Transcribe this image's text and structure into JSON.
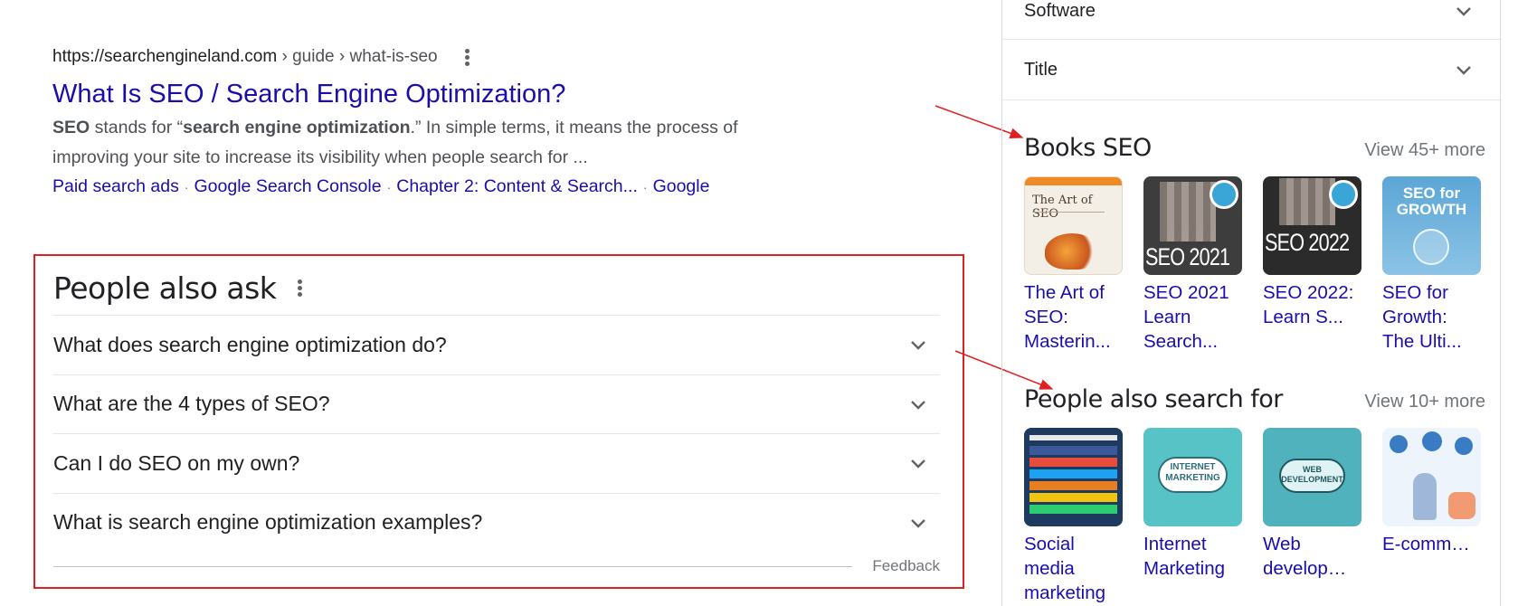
{
  "result": {
    "cite_domain": "https://searchengineland.com",
    "cite_path": " › guide › what-is-seo",
    "title": "What Is SEO / Search Engine Optimization?",
    "snippet_line1_parts": [
      "SEO",
      " stands for “",
      "search engine optimization",
      ".” In simple terms, it means the process of"
    ],
    "snippet_line2": "improving your site to increase its visibility when people search for ...",
    "sitelinks": [
      "Paid search ads",
      "Google Search Console",
      "Chapter 2: Content & Search...",
      "Google"
    ],
    "sitelink_separator": "·"
  },
  "people_also_ask": {
    "title": "People also ask",
    "questions": [
      "What does search engine optimization do?",
      "What are the 4 types of SEO?",
      "Can I do SEO on my own?",
      "What is search engine optimization examples?"
    ],
    "feedback": "Feedback"
  },
  "side_panel": {
    "accordions": [
      "Software",
      "Title"
    ],
    "books": {
      "title": "Books SEO",
      "more": "View 45+ more",
      "items": [
        {
          "label": "The Art of SEO: Masterin...",
          "cover_title": "The Art of SEO"
        },
        {
          "label": "SEO 2021 Learn Search...",
          "cover_title": "SEO 2021"
        },
        {
          "label": "SEO 2022: Learn S...",
          "cover_title": "SEO 2022"
        },
        {
          "label": "SEO for Growth: The Ulti...",
          "cover_title": "SEO for GROWTH"
        }
      ]
    },
    "related": {
      "title": "People also search for",
      "more": "View 10+ more",
      "items": [
        {
          "label": "Social media marketing"
        },
        {
          "label": "Internet Marketing",
          "thumb_text": "INTERNET MARKETING"
        },
        {
          "label": "Web develop…",
          "thumb_text": "WEB DEVELOPMENT"
        },
        {
          "label": "E-comm…"
        }
      ]
    }
  },
  "colors": {
    "link": "#1a0dab",
    "annotation_red": "#e02020",
    "text": "#202124",
    "muted": "#70757a"
  }
}
